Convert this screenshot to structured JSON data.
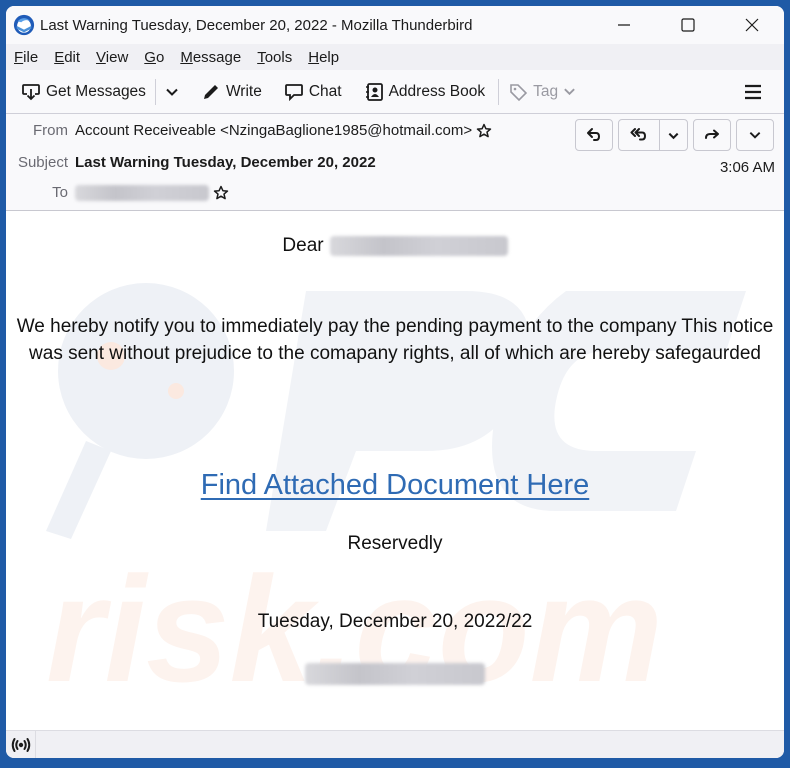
{
  "window": {
    "title": "Last Warning Tuesday, December 20, 2022 - Mozilla Thunderbird",
    "app_icon": "thunderbird-logo-icon",
    "controls": [
      "minimize-icon",
      "maximize-icon",
      "close-icon"
    ]
  },
  "menubar": {
    "items": [
      {
        "label": "File",
        "accel": "F"
      },
      {
        "label": "Edit",
        "accel": "E"
      },
      {
        "label": "View",
        "accel": "V"
      },
      {
        "label": "Go",
        "accel": "G"
      },
      {
        "label": "Message",
        "accel": "M"
      },
      {
        "label": "Tools",
        "accel": "T"
      },
      {
        "label": "Help",
        "accel": "H"
      }
    ]
  },
  "toolbar": {
    "get_messages": "Get Messages",
    "write": "Write",
    "chat": "Chat",
    "address_book": "Address Book",
    "tag": "Tag"
  },
  "header": {
    "from_label": "From",
    "from_value": "Account Receiveable <NzingaBaglione1985@hotmail.com>",
    "subject_label": "Subject",
    "subject_value": "Last Warning Tuesday, December 20, 2022",
    "to_label": "To",
    "to_value_redacted": true,
    "time": "3:06 AM",
    "buttons": [
      "reply",
      "reply-all",
      "reply-all-menu",
      "forward",
      "more-menu"
    ]
  },
  "message": {
    "greeting": "Dear",
    "paragraph": "We hereby notify you to immediately pay the pending payment to the company This notice was sent without prejudice to the comapany rights, all of which are hereby safegaurded",
    "link_text": "Find Attached Document Here",
    "closing": "Reservedly",
    "date_line": "Tuesday, December 20, 2022/22",
    "signature_redacted": true
  },
  "colors": {
    "frame": "#1f5aa6",
    "link": "#2f6bb4"
  }
}
